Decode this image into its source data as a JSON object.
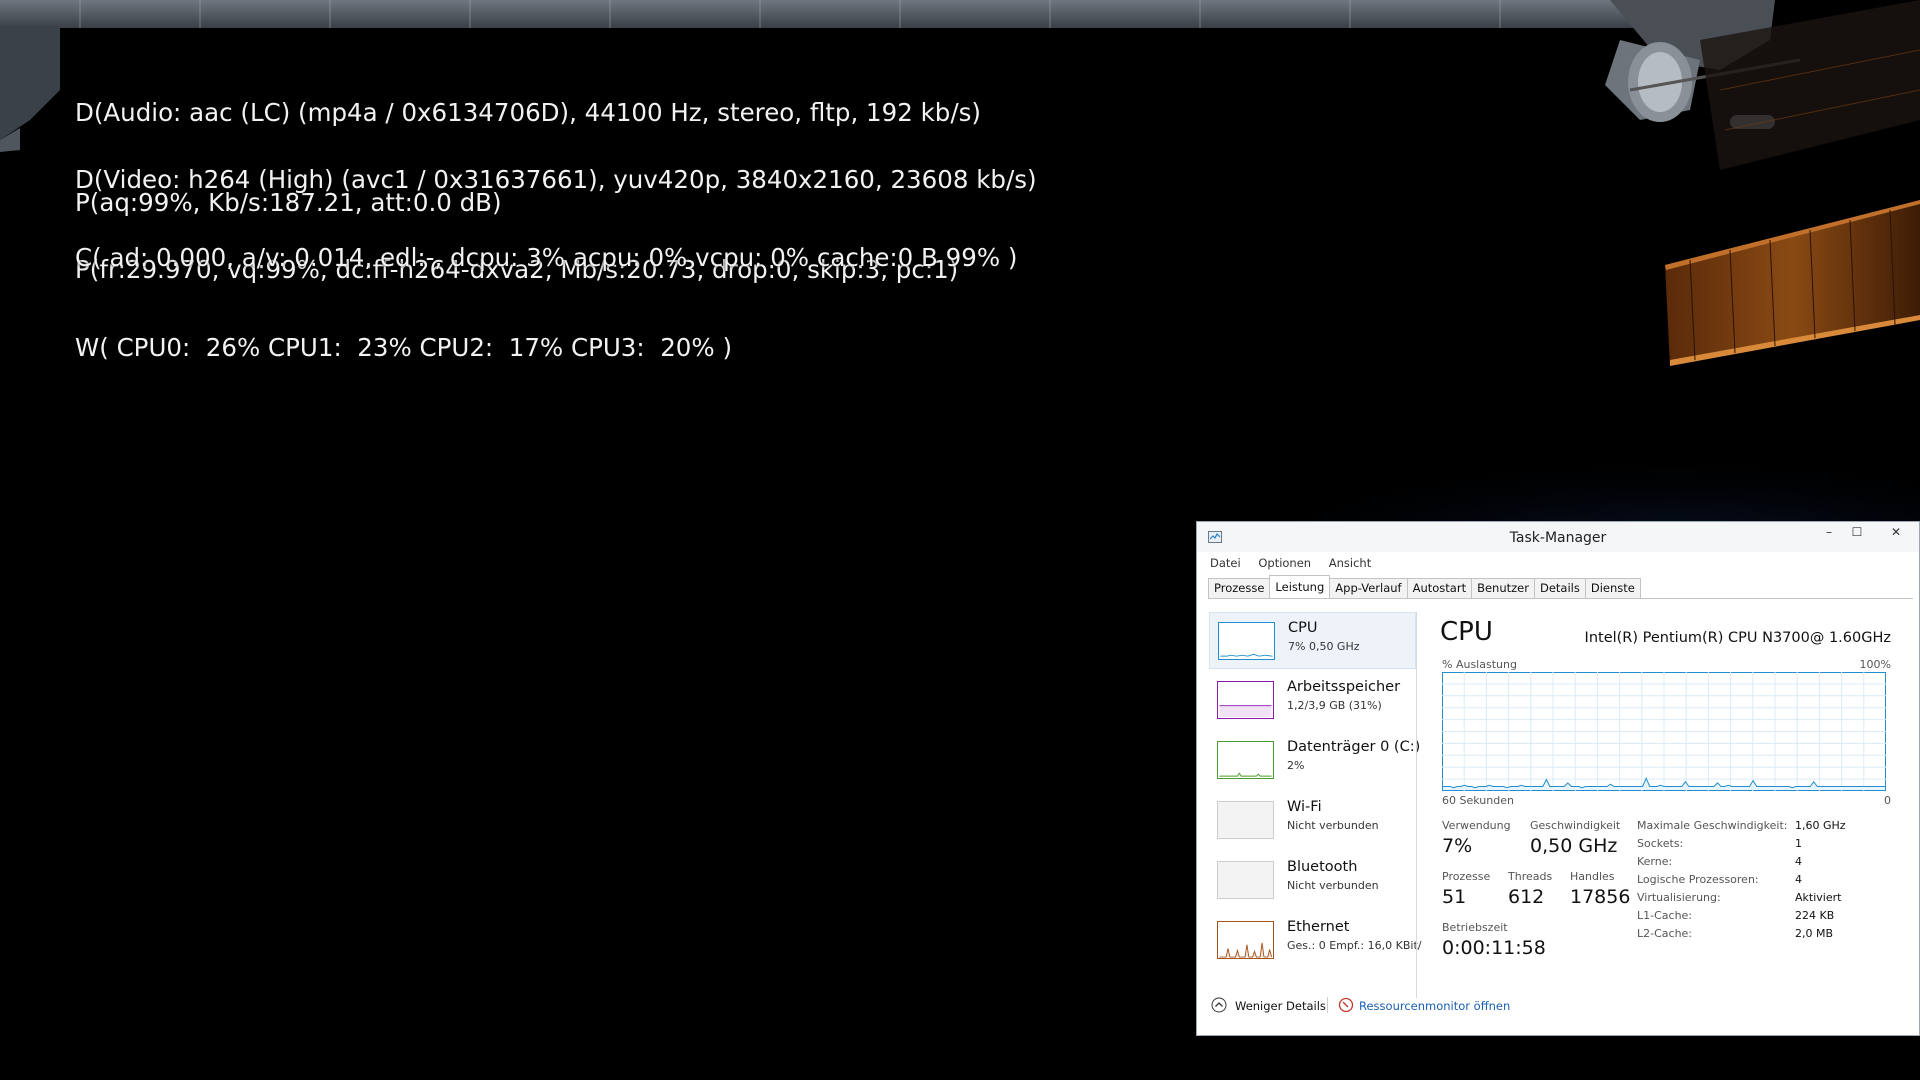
{
  "osd": {
    "audio_line1": "D(Audio: aac (LC) (mp4a / 0x6134706D), 44100 Hz, stereo, fltp, 192 kb/s)",
    "audio_line2": "P(aq:99%, Kb/s:187.21, att:0.0 dB)",
    "video_line1": "D(Video: h264 (High) (avc1 / 0x31637661), yuv420p, 3840x2160, 23608 kb/s)",
    "video_line2": "P(fr:29.970, vq:99%, dc:ff-h264-dxva2, Mb/s:20.73, drop:0, skip:3, pc:1)",
    "cpu_line1": "C( ad: 0.000, a/v: 0.014, edl:-, dcpu: 3% acpu: 0% vcpu: 0% cache:0 B 99% )",
    "cpu_line2": "W( CPU0:  26% CPU1:  23% CPU2:  17% CPU3:  20% )"
  },
  "taskmanager": {
    "title": "Task-Manager",
    "window_buttons": {
      "minimize": "–",
      "maximize": "☐",
      "close": "✕"
    },
    "menu": [
      "Datei",
      "Optionen",
      "Ansicht"
    ],
    "tabs": [
      "Prozesse",
      "Leistung",
      "App-Verlauf",
      "Autostart",
      "Benutzer",
      "Details",
      "Dienste"
    ],
    "active_tab": "Leistung",
    "resources": [
      {
        "name": "CPU",
        "value": "7% 0,50 GHz",
        "color": "#1f8fd1"
      },
      {
        "name": "Arbeitsspeicher",
        "value": "1,2/3,9 GB (31%)",
        "color": "#8b1cb1"
      },
      {
        "name": "Datenträger 0 (C:)",
        "value": "2%",
        "color": "#4c9a2a"
      },
      {
        "name": "Wi-Fi",
        "value": "Nicht verbunden",
        "color": "#aaaaaa"
      },
      {
        "name": "Bluetooth",
        "value": "Nicht verbunden",
        "color": "#aaaaaa"
      },
      {
        "name": "Ethernet",
        "value": "Ges.: 0 Empf.: 16,0 KBit/",
        "color": "#a6541e"
      }
    ],
    "cpu": {
      "title": "CPU",
      "model": "Intel(R) Pentium(R) CPU N3700@ 1.60GHz",
      "util_label": "% Auslastung",
      "util_max": "100%",
      "time_left": "60 Sekunden",
      "time_right": "0",
      "graph_color": "#1f8fd1",
      "graph_values": [
        3,
        3,
        3,
        2,
        3,
        3,
        4,
        3,
        3,
        2,
        3,
        3,
        3,
        4,
        3,
        3,
        3,
        3,
        2,
        3,
        3,
        3,
        4,
        3,
        3,
        3,
        3,
        3,
        3,
        9,
        3,
        3,
        3,
        3,
        3,
        6,
        3,
        3,
        3,
        2,
        3,
        3,
        3,
        3,
        3,
        3,
        3,
        5,
        3,
        3,
        3,
        3,
        3,
        3,
        3,
        3,
        3,
        10,
        3,
        3,
        3,
        4,
        3,
        3,
        3,
        3,
        3,
        3,
        7,
        3,
        3,
        3,
        3,
        3,
        3,
        3,
        3,
        6,
        3,
        3,
        4,
        3,
        3,
        3,
        3,
        3,
        3,
        8,
        3,
        3,
        3,
        3,
        3,
        3,
        3,
        3,
        3,
        3,
        2,
        3,
        3,
        3,
        3,
        3,
        7,
        3,
        3,
        3,
        3,
        3,
        3,
        3,
        3,
        3,
        3,
        3,
        3,
        3,
        3,
        3,
        3,
        3,
        3,
        3,
        3
      ],
      "stats": {
        "verwendung_label": "Verwendung",
        "verwendung": "7%",
        "geschwindigkeit_label": "Geschwindigkeit",
        "geschwindigkeit": "0,50 GHz",
        "prozesse_label": "Prozesse",
        "prozesse": "51",
        "threads_label": "Threads",
        "threads": "612",
        "handles_label": "Handles",
        "handles": "17856",
        "betriebszeit_label": "Betriebszeit",
        "betriebszeit": "0:00:11:58"
      },
      "specs": [
        {
          "key": "Maximale Geschwindigkeit:",
          "value": "1,60 GHz"
        },
        {
          "key": "Sockets:",
          "value": "1"
        },
        {
          "key": "Kerne:",
          "value": "4"
        },
        {
          "key": "Logische Prozessoren:",
          "value": "4"
        },
        {
          "key": "Virtualisierung:",
          "value": "Aktiviert"
        },
        {
          "key": "L1-Cache:",
          "value": "224 KB"
        },
        {
          "key": "L2-Cache:",
          "value": "2,0 MB"
        }
      ]
    },
    "bottom": {
      "less_details": "Weniger Details",
      "resource_monitor": "Ressourcenmonitor öffnen"
    }
  }
}
